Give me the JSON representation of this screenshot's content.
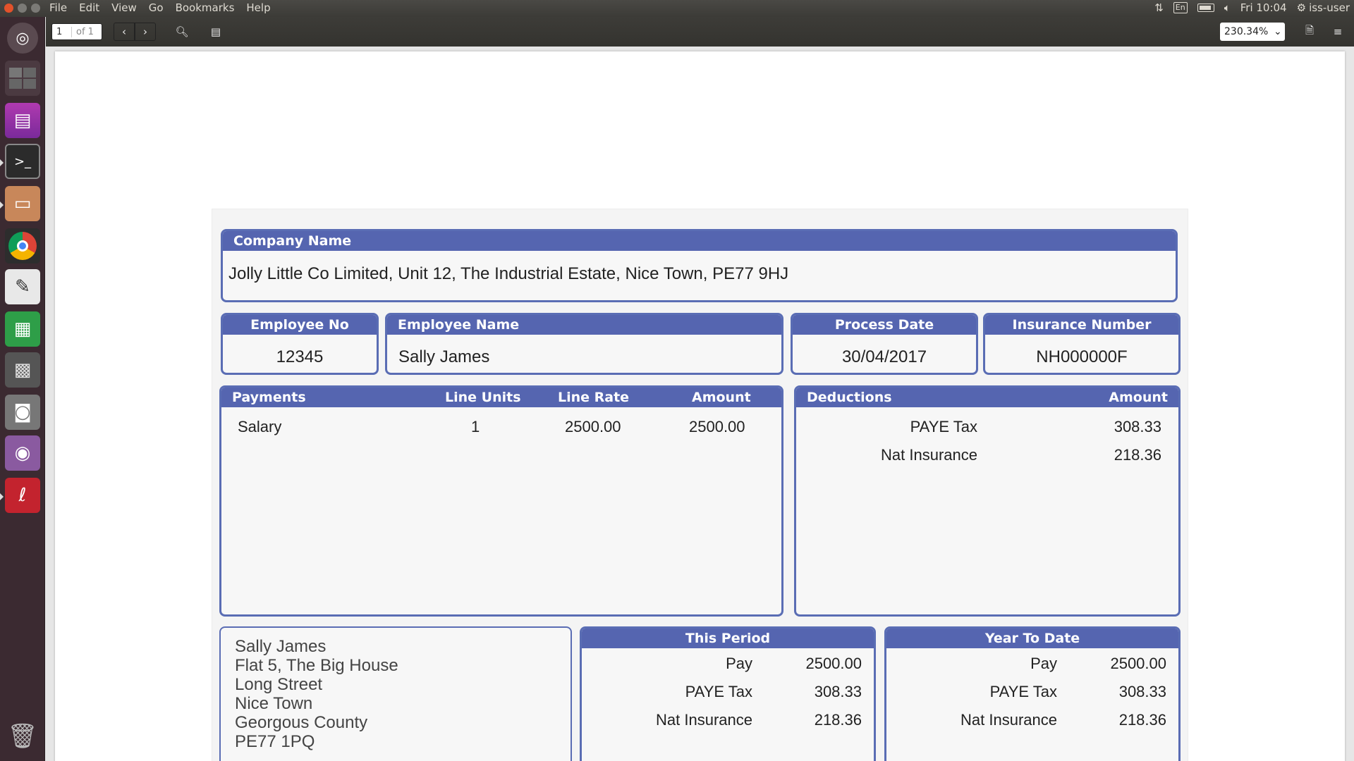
{
  "menubar": {
    "menus": [
      "File",
      "Edit",
      "View",
      "Go",
      "Bookmarks",
      "Help"
    ],
    "keyboard": "En",
    "clock": "Fri 10:04",
    "user": "iss-user"
  },
  "toolbar": {
    "page_value": "1",
    "page_of": "of 1",
    "zoom": "230.34%"
  },
  "payslip": {
    "company": {
      "header": "Company Name",
      "value": "Jolly Little Co Limited, Unit 12, The Industrial Estate, Nice Town, PE77 9HJ"
    },
    "employee_no": {
      "header": "Employee No",
      "value": "12345"
    },
    "employee_name": {
      "header": "Employee Name",
      "value": "Sally James"
    },
    "process_date": {
      "header": "Process Date",
      "value": "30/04/2017"
    },
    "insurance": {
      "header": "Insurance Number",
      "value": "NH000000F"
    },
    "payments": {
      "headers": {
        "label": "Payments",
        "units": "Line Units",
        "rate": "Line Rate",
        "amount": "Amount"
      },
      "rows": [
        {
          "label": "Salary",
          "units": "1",
          "rate": "2500.00",
          "amount": "2500.00"
        }
      ]
    },
    "deductions": {
      "headers": {
        "label": "Deductions",
        "amount": "Amount"
      },
      "rows": [
        {
          "label": "PAYE Tax",
          "amount": "308.33"
        },
        {
          "label": "Nat Insurance",
          "amount": "218.36"
        }
      ]
    },
    "address": [
      "Sally James",
      "Flat 5, The Big House",
      "Long Street",
      "Nice Town",
      "Georgous County",
      "PE77 1PQ"
    ],
    "this_period": {
      "header": "This Period",
      "rows": [
        {
          "label": "Pay",
          "amount": "2500.00"
        },
        {
          "label": "PAYE Tax",
          "amount": "308.33"
        },
        {
          "label": "Nat Insurance",
          "amount": "218.36"
        }
      ]
    },
    "year_to_date": {
      "header": "Year To Date",
      "rows": [
        {
          "label": "Pay",
          "amount": "2500.00"
        },
        {
          "label": "PAYE Tax",
          "amount": "308.33"
        },
        {
          "label": "Nat Insurance",
          "amount": "218.36"
        }
      ]
    }
  },
  "colors": {
    "accent": "#5565b0",
    "launcher_bg": "#3b2a31",
    "toolbar_bg": "#3c3b37"
  },
  "launcher_icons": [
    "ubuntu-dash-icon",
    "workspace-switcher-icon",
    "app-window-icon",
    "terminal-icon",
    "file-manager-icon",
    "chrome-icon",
    "text-editor-icon",
    "spreadsheet-icon",
    "calculator-icon",
    "screenshot-icon",
    "image-viewer-icon",
    "document-viewer-icon",
    "trash-icon"
  ]
}
